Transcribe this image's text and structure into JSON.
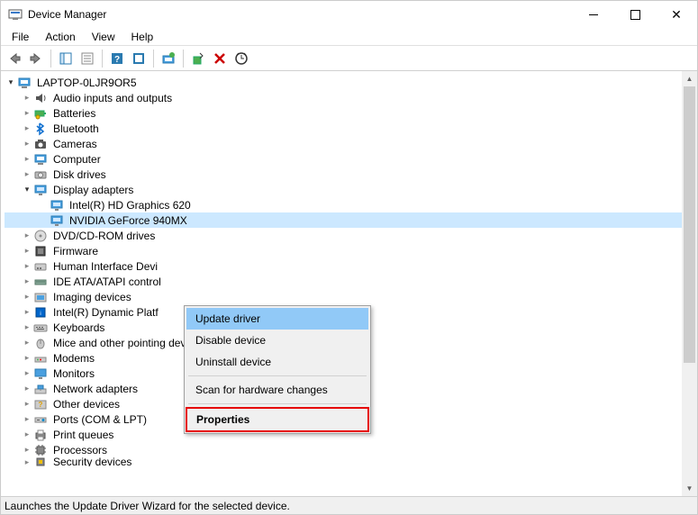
{
  "window": {
    "title": "Device Manager"
  },
  "menubar": [
    "File",
    "Action",
    "View",
    "Help"
  ],
  "root": {
    "name": "LAPTOP-0LJR9OR5"
  },
  "categories": [
    {
      "label": "Audio inputs and outputs",
      "expanded": false,
      "icon": "audio"
    },
    {
      "label": "Batteries",
      "expanded": false,
      "icon": "battery"
    },
    {
      "label": "Bluetooth",
      "expanded": false,
      "icon": "bluetooth"
    },
    {
      "label": "Cameras",
      "expanded": false,
      "icon": "camera"
    },
    {
      "label": "Computer",
      "expanded": false,
      "icon": "computer"
    },
    {
      "label": "Disk drives",
      "expanded": false,
      "icon": "disk"
    },
    {
      "label": "Display adapters",
      "expanded": true,
      "icon": "display",
      "children": [
        {
          "label": "Intel(R) HD Graphics 620",
          "icon": "display"
        },
        {
          "label": "NVIDIA GeForce 940MX",
          "icon": "display",
          "selected": true
        }
      ]
    },
    {
      "label": "DVD/CD-ROM drives",
      "expanded": false,
      "icon": "dvd"
    },
    {
      "label": "Firmware",
      "expanded": false,
      "icon": "firmware"
    },
    {
      "label": "Human Interface Devi",
      "expanded": false,
      "icon": "hid",
      "truncated": true
    },
    {
      "label": "IDE ATA/ATAPI control",
      "expanded": false,
      "icon": "ide",
      "truncated": true
    },
    {
      "label": "Imaging devices",
      "expanded": false,
      "icon": "imaging"
    },
    {
      "label": "Intel(R) Dynamic Platf",
      "expanded": false,
      "icon": "intel",
      "truncated": true
    },
    {
      "label": "Keyboards",
      "expanded": false,
      "icon": "keyboard"
    },
    {
      "label": "Mice and other pointing devices",
      "expanded": false,
      "icon": "mouse"
    },
    {
      "label": "Modems",
      "expanded": false,
      "icon": "modem"
    },
    {
      "label": "Monitors",
      "expanded": false,
      "icon": "monitor"
    },
    {
      "label": "Network adapters",
      "expanded": false,
      "icon": "network"
    },
    {
      "label": "Other devices",
      "expanded": false,
      "icon": "other"
    },
    {
      "label": "Ports (COM & LPT)",
      "expanded": false,
      "icon": "port"
    },
    {
      "label": "Print queues",
      "expanded": false,
      "icon": "print"
    },
    {
      "label": "Processors",
      "expanded": false,
      "icon": "cpu"
    },
    {
      "label": "Security devices",
      "expanded": false,
      "icon": "security",
      "partial": true
    }
  ],
  "context_menu": {
    "items": [
      {
        "label": "Update driver",
        "highlight": true
      },
      {
        "label": "Disable device"
      },
      {
        "label": "Uninstall device"
      },
      {
        "sep": true
      },
      {
        "label": "Scan for hardware changes"
      },
      {
        "sep": true
      },
      {
        "label": "Properties",
        "bold": true,
        "redbox": true
      }
    ]
  },
  "statusbar": {
    "text": "Launches the Update Driver Wizard for the selected device."
  }
}
